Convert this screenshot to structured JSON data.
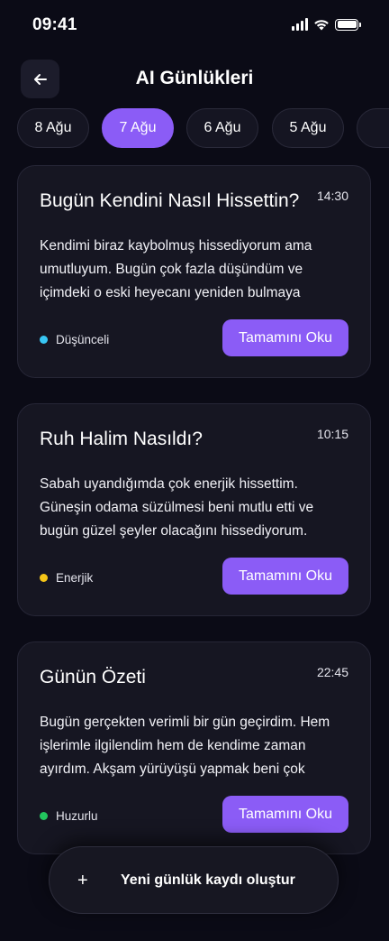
{
  "status_bar": {
    "time": "09:41"
  },
  "header": {
    "title": "AI Günlükleri"
  },
  "date_tabs": [
    {
      "label": "8 Ağu",
      "active": false
    },
    {
      "label": "7 Ağu",
      "active": true
    },
    {
      "label": "6 Ağu",
      "active": false
    },
    {
      "label": "5 Ağu",
      "active": false
    },
    {
      "label": "",
      "active": false
    }
  ],
  "entries": [
    {
      "title": "Bugün Kendini Nasıl Hissettin?",
      "time": "14:30",
      "text": "Kendimi biraz kaybolmuş hissediyorum ama umutluyum. Bugün çok fazla düşündüm ve içimdeki o eski heyecanı yeniden bulmaya",
      "mood": "Düşünceli",
      "mood_color": "#38c6f4",
      "button": "Tamamını Oku"
    },
    {
      "title": "Ruh Halim Nasıldı?",
      "time": "10:15",
      "text": "Sabah uyandığımda çok enerjik hissettim. Güneşin odama süzülmesi beni mutlu etti ve bugün güzel şeyler olacağını hissediyorum.",
      "mood": "Enerjik",
      "mood_color": "#f5c518",
      "button": "Tamamını Oku"
    },
    {
      "title": "Günün Özeti",
      "time": "22:45",
      "text": "Bugün gerçekten verimli bir gün geçirdim. Hem işlerimle ilgilendim hem de kendime zaman ayırdım. Akşam yürüyüşü yapmak beni çok",
      "mood": "Huzurlu",
      "mood_color": "#22c55e",
      "button": "Tamamını Oku"
    }
  ],
  "new_entry": {
    "icon": "+",
    "label": "Yeni günlük kaydı oluştur"
  },
  "colors": {
    "accent": "#8b5cf6",
    "background": "#0b0b16",
    "card": "#161622"
  }
}
